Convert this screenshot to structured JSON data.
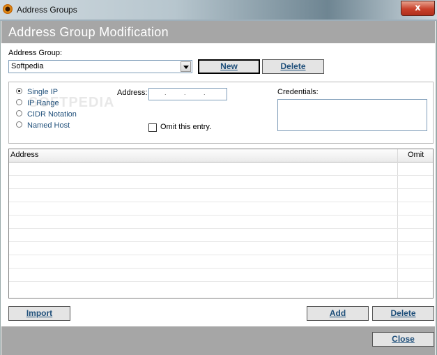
{
  "window": {
    "title": "Address Groups",
    "close_glyph": "x"
  },
  "header": {
    "title": "Address Group Modification"
  },
  "group": {
    "label": "Address Group:",
    "selected": "Softpedia",
    "new_label": "New",
    "delete_label": "Delete"
  },
  "type_options": [
    {
      "label": "Single IP",
      "checked": true
    },
    {
      "label": "IP Range",
      "checked": false
    },
    {
      "label": "CIDR Notation",
      "checked": false
    },
    {
      "label": "Named Host",
      "checked": false
    }
  ],
  "address": {
    "label": "Address:",
    "dots": [
      ".",
      ".",
      "."
    ]
  },
  "omit": {
    "label": "Omit this entry.",
    "checked": false
  },
  "credentials": {
    "label": "Credentials:",
    "value": ""
  },
  "list": {
    "columns": [
      "Address",
      "Omit"
    ],
    "rows": []
  },
  "actions": {
    "import_label": "Import",
    "add_label": "Add",
    "delete_label": "Delete",
    "close_label": "Close"
  },
  "watermark": "SOFTPEDIA"
}
